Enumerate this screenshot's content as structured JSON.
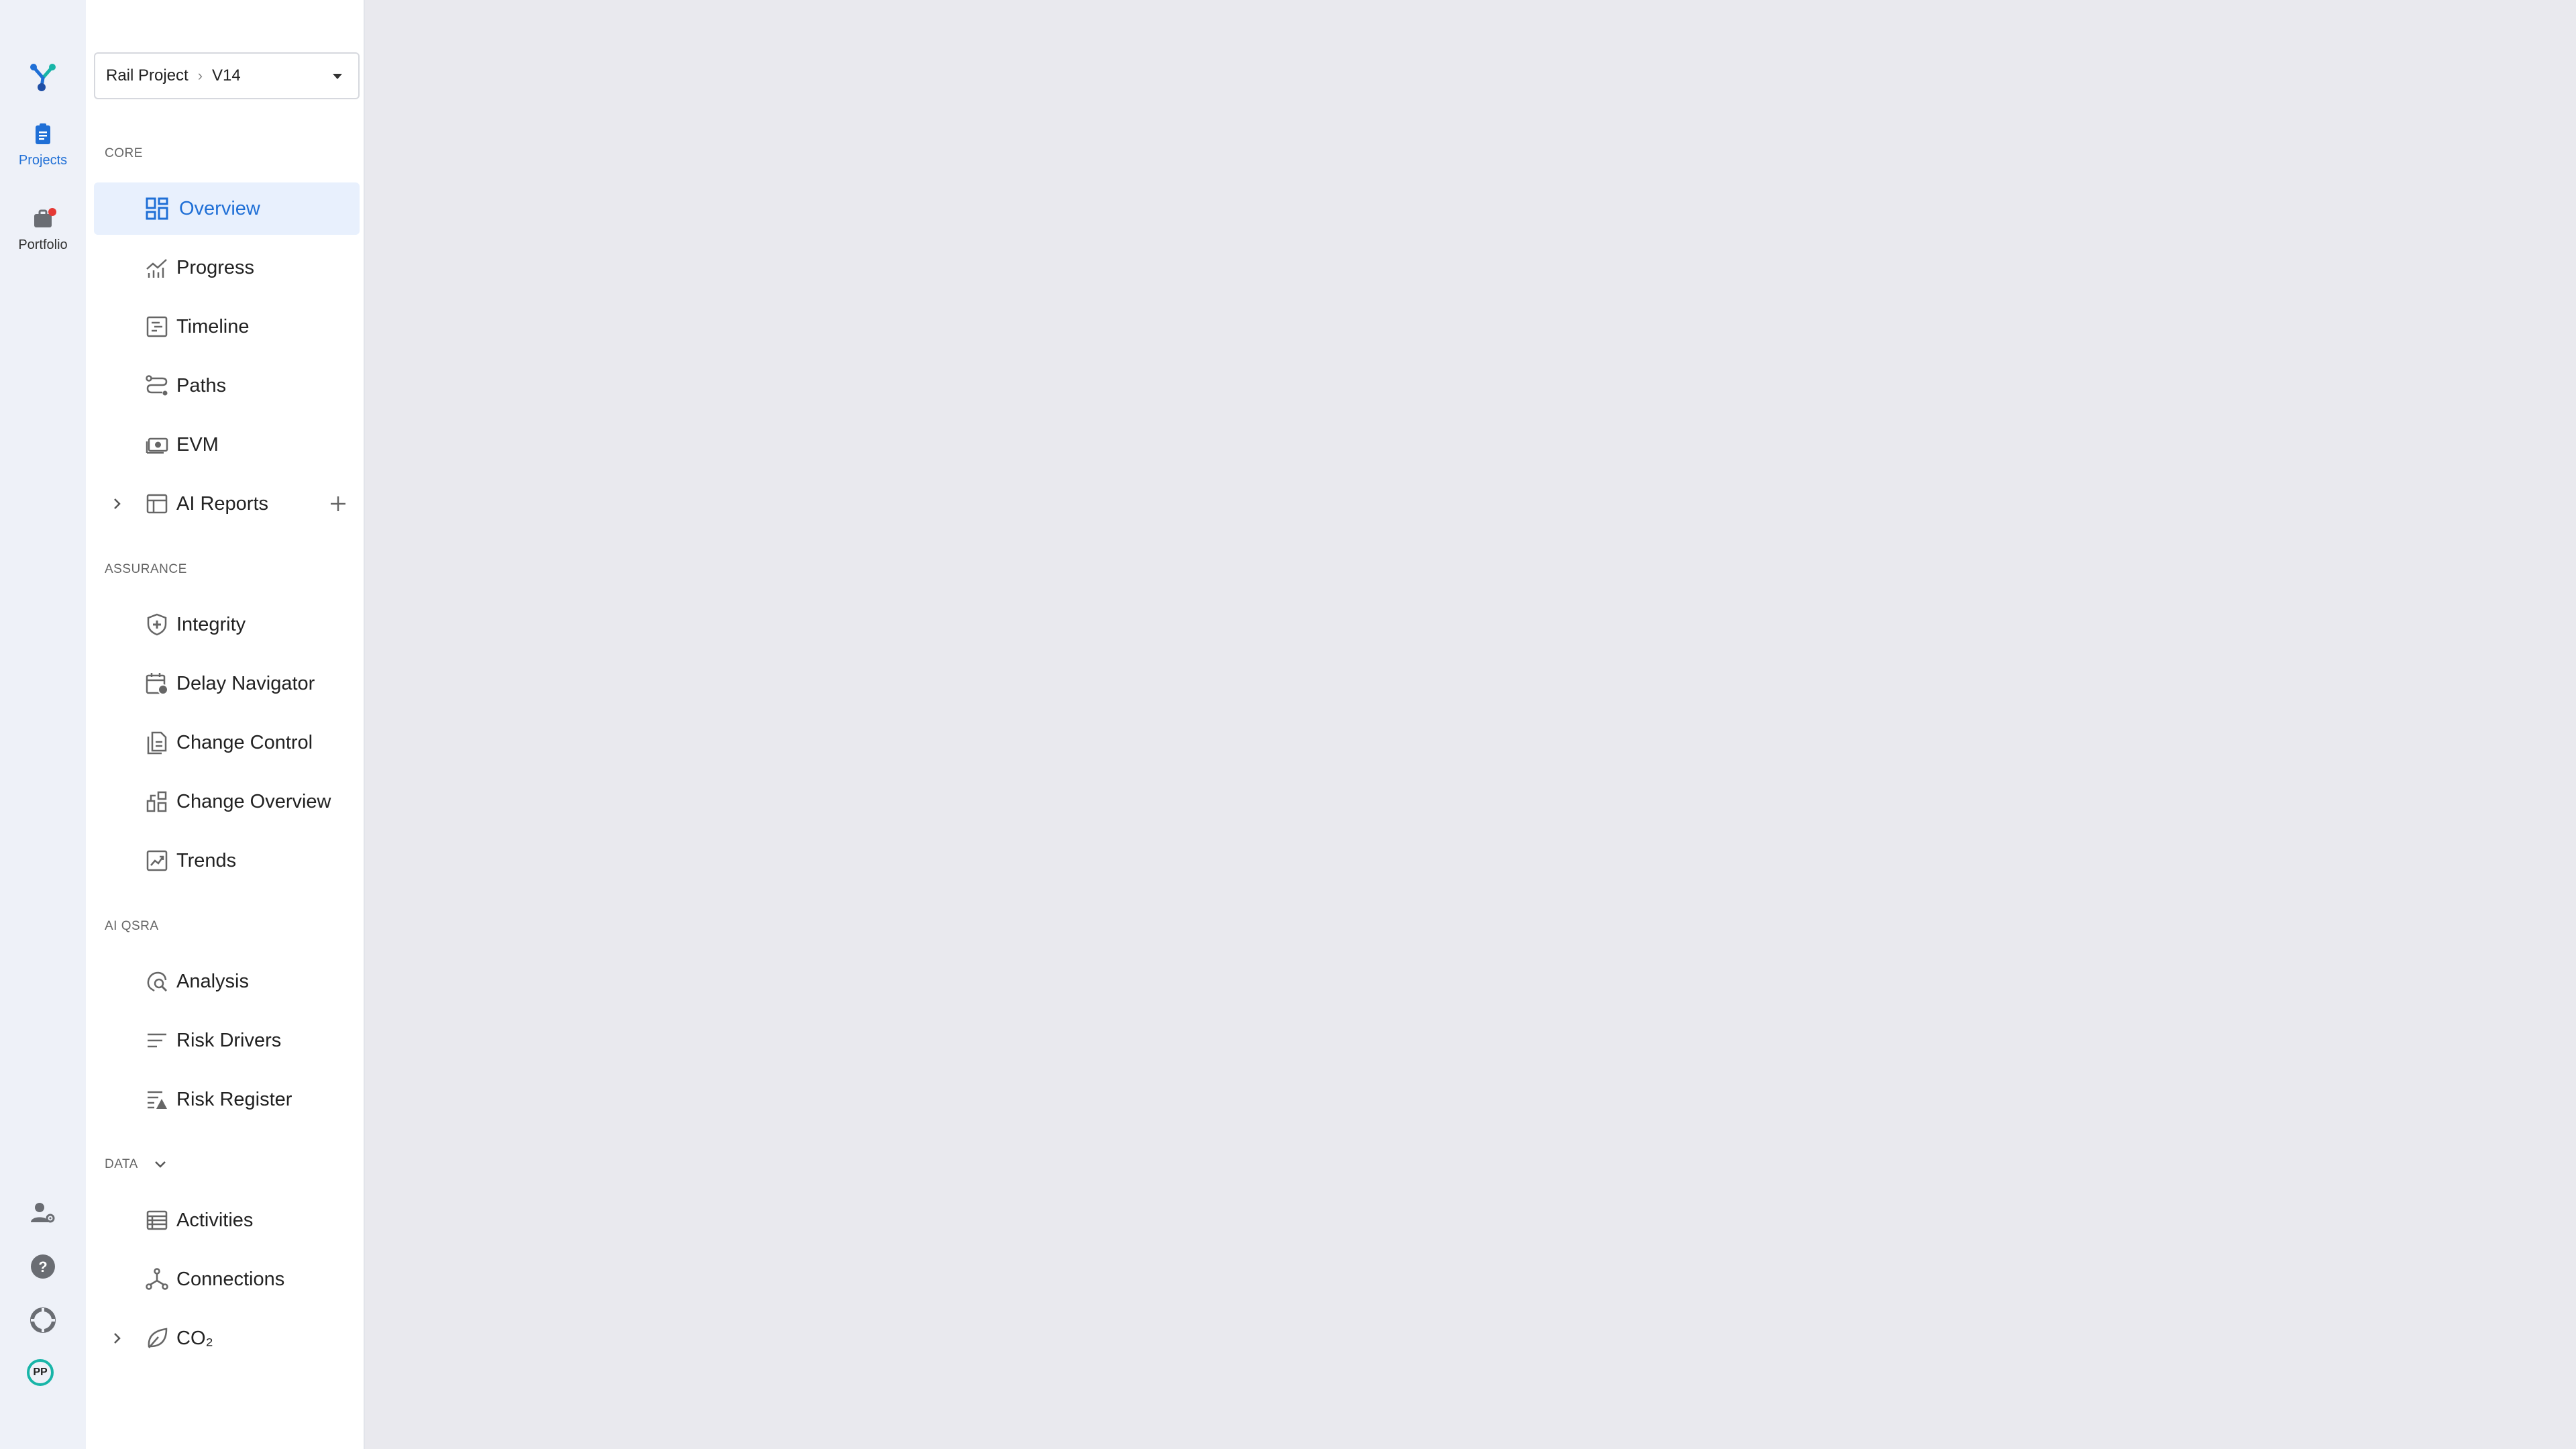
{
  "rail": {
    "projects_label": "Projects",
    "portfolio_label": "Portfolio",
    "avatar_initials": "PP"
  },
  "selector": {
    "project": "Rail Project",
    "version": "V14"
  },
  "sections": {
    "core": "CORE",
    "assurance": "ASSURANCE",
    "ai_qsra": "AI QSRA",
    "data": "DATA"
  },
  "core_items": [
    {
      "label": "Overview",
      "icon": "dashboard-icon",
      "active": true
    },
    {
      "label": "Progress",
      "icon": "progress-chart-icon"
    },
    {
      "label": "Timeline",
      "icon": "timeline-icon"
    },
    {
      "label": "Paths",
      "icon": "paths-icon"
    },
    {
      "label": "EVM",
      "icon": "money-icon"
    },
    {
      "label": "AI Reports",
      "icon": "table-icon"
    }
  ],
  "assurance_items": [
    {
      "label": "Integrity",
      "icon": "shield-icon"
    },
    {
      "label": "Delay Navigator",
      "icon": "calendar-clock-icon"
    },
    {
      "label": "Change Control",
      "icon": "documents-icon"
    },
    {
      "label": "Change Overview",
      "icon": "change-overview-icon"
    },
    {
      "label": "Trends",
      "icon": "trend-icon"
    }
  ],
  "qsra_items": [
    {
      "label": "Analysis",
      "icon": "analysis-icon"
    },
    {
      "label": "Risk Drivers",
      "icon": "lines-icon"
    },
    {
      "label": "Risk Register",
      "icon": "risk-register-icon"
    }
  ],
  "data_items": [
    {
      "label": "Activities",
      "icon": "list-table-icon"
    },
    {
      "label": "Connections",
      "icon": "connections-icon"
    },
    {
      "label": "CO₂",
      "icon": "leaf-icon"
    }
  ],
  "colors": {
    "accent": "#1f6fd6",
    "active_bg": "#e8f0fd",
    "notification": "#e53935",
    "avatar_ring": "#18b5a8"
  }
}
